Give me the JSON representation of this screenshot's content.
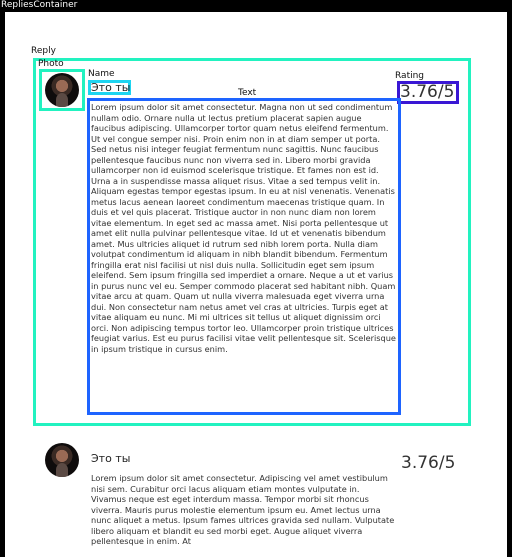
{
  "frame": {
    "title": "RepliesContainer"
  },
  "labels": {
    "reply": "Reply",
    "photo": "Photo",
    "name": "Name",
    "text": "Text",
    "rating": "Rating"
  },
  "replies": [
    {
      "name": "Это ты",
      "rating": "3.76/5",
      "text": "Lorem ipsum dolor sit amet consectetur. Magna non ut sed condimentum nullam odio. Ornare nulla ut lectus pretium placerat sapien augue faucibus adipiscing. Ullamcorper tortor quam netus eleifend fermentum. Ut vel congue semper nisi. Proin enim non in at diam semper ut porta. Sed netus nisi integer feugiat fermentum nunc sagittis. Nunc faucibus pellentesque faucibus nunc non viverra sed in. Libero morbi gravida ullamcorper non id euismod scelerisque tristique. Et fames non est id. Urna a in suspendisse massa aliquet risus. Vitae a sed tempus velit in. Aliquam egestas tempor egestas ipsum. In eu at nisl venenatis. Venenatis metus lacus aenean laoreet condimentum maecenas tristique quam. In duis et vel quis placerat. Tristique auctor in non nunc diam non lorem vitae elementum. In eget sed ac massa amet. Nisi porta pellentesque ut amet elit nulla pulvinar pellentesque vitae. Id ut et venenatis bibendum amet. Mus ultricies aliquet id rutrum sed nibh lorem porta. Nulla diam volutpat condimentum id aliquam in nibh blandit bibendum. Fermentum fringilla erat nisl facilisi ut nisl duis nulla. Sollicitudin eget sem ipsum eleifend. Sem ipsum fringilla sed imperdiet a ornare. Neque a ut et varius in purus nunc vel eu. Semper commodo placerat sed habitant nibh. Quam vitae arcu at quam. Quam ut nulla viverra malesuada eget viverra urna dui. Non consectetur nam netus amet vel cras at ultricies. Turpis eget at vitae aliquam eu nunc. Mi mi ultrices sit tellus ut aliquet dignissim orci orci. Non adipiscing tempus tortor leo. Ullamcorper proin tristique ultrices feugiat varius. Est eu purus facilisi vitae velit pellentesque sit. Scelerisque in ipsum tristique in cursus enim."
    },
    {
      "name": "Это ты",
      "rating": "3.76/5",
      "text": "Lorem ipsum dolor sit amet consectetur. Adipiscing vel amet vestibulum nisi sem. Curabitur orci lacus aliquam etiam montes vulputate in. Vivamus neque est eget interdum massa. Tempor morbi sit rhoncus viverra. Mauris purus molestie elementum ipsum eu. Amet lectus urna nunc aliquet a metus. Ipsum fames ultrices gravida sed nullam. Vulputate libero aliquam et blandit eu sed morbi eget. Augue aliquet viverra pellentesque in enim. At"
    }
  ]
}
